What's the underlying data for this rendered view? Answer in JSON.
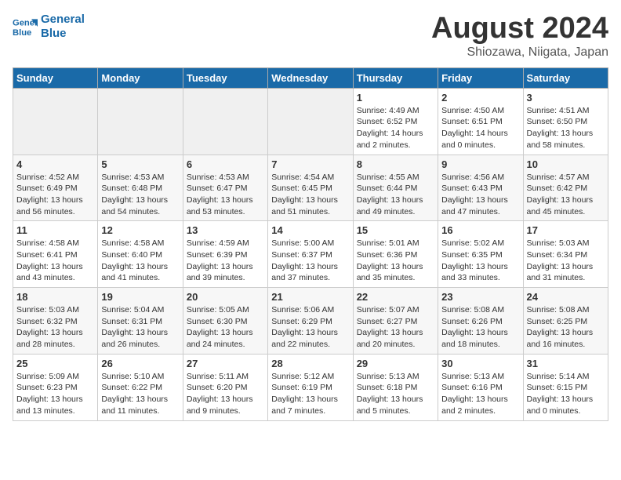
{
  "logo": {
    "text_general": "General",
    "text_blue": "Blue"
  },
  "header": {
    "title": "August 2024",
    "subtitle": "Shiozawa, Niigata, Japan"
  },
  "weekdays": [
    "Sunday",
    "Monday",
    "Tuesday",
    "Wednesday",
    "Thursday",
    "Friday",
    "Saturday"
  ],
  "weeks": [
    [
      {
        "day": "",
        "sunrise": "",
        "sunset": "",
        "daylight": ""
      },
      {
        "day": "",
        "sunrise": "",
        "sunset": "",
        "daylight": ""
      },
      {
        "day": "",
        "sunrise": "",
        "sunset": "",
        "daylight": ""
      },
      {
        "day": "",
        "sunrise": "",
        "sunset": "",
        "daylight": ""
      },
      {
        "day": "1",
        "sunrise": "Sunrise: 4:49 AM",
        "sunset": "Sunset: 6:52 PM",
        "daylight": "Daylight: 14 hours and 2 minutes."
      },
      {
        "day": "2",
        "sunrise": "Sunrise: 4:50 AM",
        "sunset": "Sunset: 6:51 PM",
        "daylight": "Daylight: 14 hours and 0 minutes."
      },
      {
        "day": "3",
        "sunrise": "Sunrise: 4:51 AM",
        "sunset": "Sunset: 6:50 PM",
        "daylight": "Daylight: 13 hours and 58 minutes."
      }
    ],
    [
      {
        "day": "4",
        "sunrise": "Sunrise: 4:52 AM",
        "sunset": "Sunset: 6:49 PM",
        "daylight": "Daylight: 13 hours and 56 minutes."
      },
      {
        "day": "5",
        "sunrise": "Sunrise: 4:53 AM",
        "sunset": "Sunset: 6:48 PM",
        "daylight": "Daylight: 13 hours and 54 minutes."
      },
      {
        "day": "6",
        "sunrise": "Sunrise: 4:53 AM",
        "sunset": "Sunset: 6:47 PM",
        "daylight": "Daylight: 13 hours and 53 minutes."
      },
      {
        "day": "7",
        "sunrise": "Sunrise: 4:54 AM",
        "sunset": "Sunset: 6:45 PM",
        "daylight": "Daylight: 13 hours and 51 minutes."
      },
      {
        "day": "8",
        "sunrise": "Sunrise: 4:55 AM",
        "sunset": "Sunset: 6:44 PM",
        "daylight": "Daylight: 13 hours and 49 minutes."
      },
      {
        "day": "9",
        "sunrise": "Sunrise: 4:56 AM",
        "sunset": "Sunset: 6:43 PM",
        "daylight": "Daylight: 13 hours and 47 minutes."
      },
      {
        "day": "10",
        "sunrise": "Sunrise: 4:57 AM",
        "sunset": "Sunset: 6:42 PM",
        "daylight": "Daylight: 13 hours and 45 minutes."
      }
    ],
    [
      {
        "day": "11",
        "sunrise": "Sunrise: 4:58 AM",
        "sunset": "Sunset: 6:41 PM",
        "daylight": "Daylight: 13 hours and 43 minutes."
      },
      {
        "day": "12",
        "sunrise": "Sunrise: 4:58 AM",
        "sunset": "Sunset: 6:40 PM",
        "daylight": "Daylight: 13 hours and 41 minutes."
      },
      {
        "day": "13",
        "sunrise": "Sunrise: 4:59 AM",
        "sunset": "Sunset: 6:39 PM",
        "daylight": "Daylight: 13 hours and 39 minutes."
      },
      {
        "day": "14",
        "sunrise": "Sunrise: 5:00 AM",
        "sunset": "Sunset: 6:37 PM",
        "daylight": "Daylight: 13 hours and 37 minutes."
      },
      {
        "day": "15",
        "sunrise": "Sunrise: 5:01 AM",
        "sunset": "Sunset: 6:36 PM",
        "daylight": "Daylight: 13 hours and 35 minutes."
      },
      {
        "day": "16",
        "sunrise": "Sunrise: 5:02 AM",
        "sunset": "Sunset: 6:35 PM",
        "daylight": "Daylight: 13 hours and 33 minutes."
      },
      {
        "day": "17",
        "sunrise": "Sunrise: 5:03 AM",
        "sunset": "Sunset: 6:34 PM",
        "daylight": "Daylight: 13 hours and 31 minutes."
      }
    ],
    [
      {
        "day": "18",
        "sunrise": "Sunrise: 5:03 AM",
        "sunset": "Sunset: 6:32 PM",
        "daylight": "Daylight: 13 hours and 28 minutes."
      },
      {
        "day": "19",
        "sunrise": "Sunrise: 5:04 AM",
        "sunset": "Sunset: 6:31 PM",
        "daylight": "Daylight: 13 hours and 26 minutes."
      },
      {
        "day": "20",
        "sunrise": "Sunrise: 5:05 AM",
        "sunset": "Sunset: 6:30 PM",
        "daylight": "Daylight: 13 hours and 24 minutes."
      },
      {
        "day": "21",
        "sunrise": "Sunrise: 5:06 AM",
        "sunset": "Sunset: 6:29 PM",
        "daylight": "Daylight: 13 hours and 22 minutes."
      },
      {
        "day": "22",
        "sunrise": "Sunrise: 5:07 AM",
        "sunset": "Sunset: 6:27 PM",
        "daylight": "Daylight: 13 hours and 20 minutes."
      },
      {
        "day": "23",
        "sunrise": "Sunrise: 5:08 AM",
        "sunset": "Sunset: 6:26 PM",
        "daylight": "Daylight: 13 hours and 18 minutes."
      },
      {
        "day": "24",
        "sunrise": "Sunrise: 5:08 AM",
        "sunset": "Sunset: 6:25 PM",
        "daylight": "Daylight: 13 hours and 16 minutes."
      }
    ],
    [
      {
        "day": "25",
        "sunrise": "Sunrise: 5:09 AM",
        "sunset": "Sunset: 6:23 PM",
        "daylight": "Daylight: 13 hours and 13 minutes."
      },
      {
        "day": "26",
        "sunrise": "Sunrise: 5:10 AM",
        "sunset": "Sunset: 6:22 PM",
        "daylight": "Daylight: 13 hours and 11 minutes."
      },
      {
        "day": "27",
        "sunrise": "Sunrise: 5:11 AM",
        "sunset": "Sunset: 6:20 PM",
        "daylight": "Daylight: 13 hours and 9 minutes."
      },
      {
        "day": "28",
        "sunrise": "Sunrise: 5:12 AM",
        "sunset": "Sunset: 6:19 PM",
        "daylight": "Daylight: 13 hours and 7 minutes."
      },
      {
        "day": "29",
        "sunrise": "Sunrise: 5:13 AM",
        "sunset": "Sunset: 6:18 PM",
        "daylight": "Daylight: 13 hours and 5 minutes."
      },
      {
        "day": "30",
        "sunrise": "Sunrise: 5:13 AM",
        "sunset": "Sunset: 6:16 PM",
        "daylight": "Daylight: 13 hours and 2 minutes."
      },
      {
        "day": "31",
        "sunrise": "Sunrise: 5:14 AM",
        "sunset": "Sunset: 6:15 PM",
        "daylight": "Daylight: 13 hours and 0 minutes."
      }
    ]
  ]
}
